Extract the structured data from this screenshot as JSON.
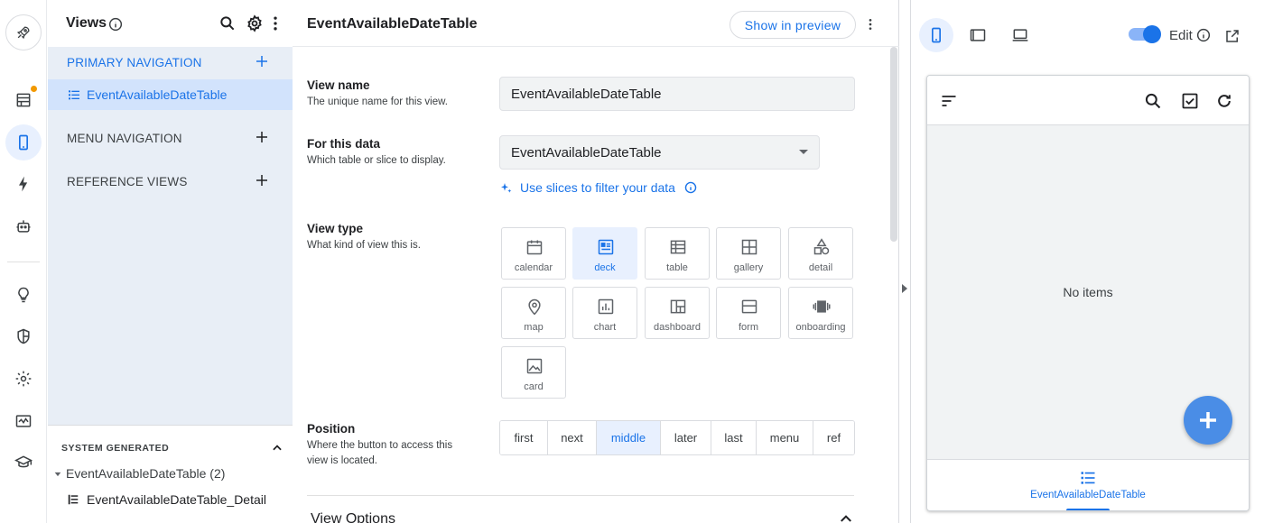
{
  "views_panel": {
    "title": "Views",
    "primary_navigation": "PRIMARY NAVIGATION",
    "primary_items": [
      {
        "label": "EventAvailableDateTable"
      }
    ],
    "menu_navigation": "MENU NAVIGATION",
    "reference_views": "REFERENCE VIEWS",
    "system_generated": {
      "title": "SYSTEM GENERATED",
      "group": "EventAvailableDateTable (2)",
      "items": [
        {
          "label": "EventAvailableDateTable_Detail"
        }
      ]
    }
  },
  "editor": {
    "title": "EventAvailableDateTable",
    "show_in_preview": "Show in preview",
    "view_name": {
      "label": "View name",
      "help": "The unique name for this view.",
      "value": "EventAvailableDateTable"
    },
    "for_this_data": {
      "label": "For this data",
      "help": "Which table or slice to display.",
      "value": "EventAvailableDateTable"
    },
    "slices_link": "Use slices to filter your data",
    "view_type": {
      "label": "View type",
      "help": "What kind of view this is.",
      "selected": "deck",
      "options": [
        "calendar",
        "deck",
        "table",
        "gallery",
        "detail",
        "map",
        "chart",
        "dashboard",
        "form",
        "onboarding",
        "card"
      ]
    },
    "position": {
      "label": "Position",
      "help": "Where the button to access this view is located.",
      "selected": "middle",
      "options": [
        "first",
        "next",
        "middle",
        "later",
        "last",
        "menu",
        "ref"
      ]
    },
    "view_options": "View Options"
  },
  "preview": {
    "edit_label": "Edit",
    "edit_enabled": true,
    "empty_text": "No items",
    "bottom_nav_label": "EventAvailableDateTable"
  },
  "colors": {
    "accent": "#1a73e8",
    "selected_bg": "#e8f0fe",
    "panel_bg": "#e8eef6",
    "fab": "#4a8de6",
    "badge": "#f29900"
  }
}
